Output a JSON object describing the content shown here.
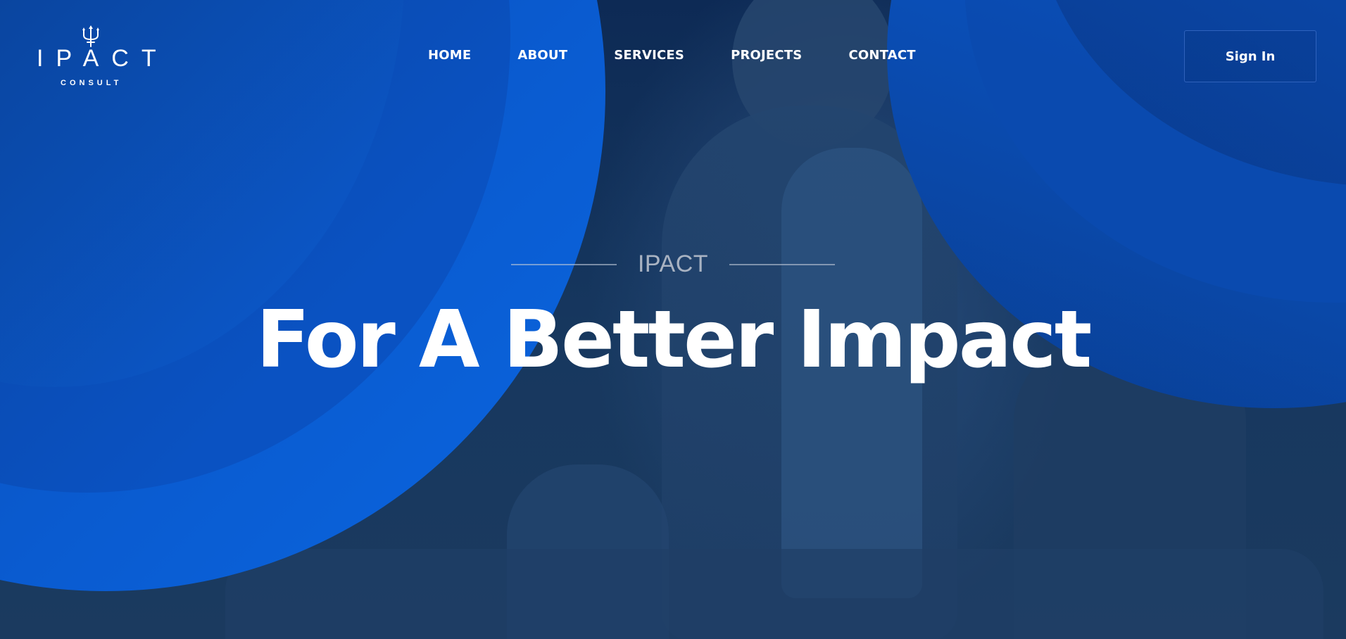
{
  "brand": {
    "logo_text": "IPACT",
    "logo_subtext": "CONSULT",
    "logo_icon": "trident-icon"
  },
  "nav": {
    "items": [
      {
        "label": "HOME"
      },
      {
        "label": "ABOUT"
      },
      {
        "label": "SERVICES"
      },
      {
        "label": "PROJECTS"
      },
      {
        "label": "CONTACT"
      }
    ],
    "signin_label": "Sign In"
  },
  "hero": {
    "eyebrow": "IPACT",
    "headline": "For A Better Impact"
  },
  "colors": {
    "accent_blue": "#0b66e0",
    "overlay_navy": "#14315c",
    "text": "#ffffff",
    "eyebrow_text": "#a9b3c2"
  }
}
